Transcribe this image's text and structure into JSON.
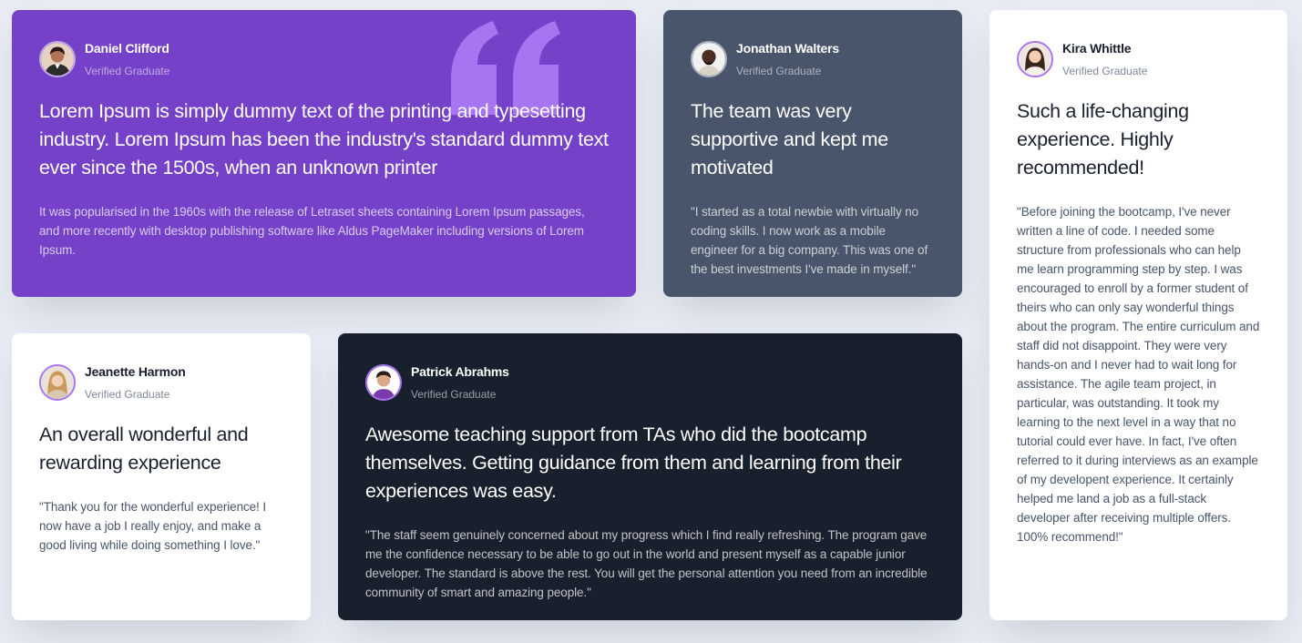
{
  "colors": {
    "background": "#e8ebf3",
    "purple": "#7541c8",
    "grayish_blue": "#48556a",
    "dark_blackish_blue": "#19202d",
    "white": "#ffffff",
    "light_purple": "#a775f1"
  },
  "testimonials": [
    {
      "name": "Daniel Clifford",
      "role": "Verified Graduate",
      "title": "Lorem Ipsum is simply dummy text of the printing and typesetting industry. Lorem Ipsum has been the industry's standard dummy text ever since the 1500s, when an unknown printer",
      "body": "It was popularised in the 1960s with the release of Letraset sheets containing Lorem Ipsum passages, and more recently with desktop publishing software like Aldus PageMaker including versions of Lorem Ipsum.",
      "decoration": "quote-icon"
    },
    {
      "name": "Jonathan Walters",
      "role": "Verified Graduate",
      "title": "The team was very supportive and kept me motivated",
      "body": "\"I started as a total newbie with virtually no coding skills. I now work as a mobile engineer for a big company. This was one of the best investments I've made in myself.\""
    },
    {
      "name": "Kira Whittle",
      "role": "Verified Graduate",
      "title": "Such a life-changing experience. Highly recommended!",
      "body": "\"Before joining the bootcamp, I've never written a line of code. I needed some structure from professionals who can help me learn programming step by step. I was encouraged to enroll by a former student of theirs who can only say wonderful things about the program. The entire curriculum and staff did not disappoint. They were very hands-on and I never had to wait long for assistance. The agile team project, in particular, was outstanding. It took my learning to the next level in a way that no tutorial could ever have. In fact, I've often referred to it during interviews as an example of my developent experience. It certainly helped me land a job as a full-stack developer after receiving multiple offers. 100% recommend!\""
    },
    {
      "name": "Jeanette Harmon",
      "role": "Verified Graduate",
      "title": "An overall wonderful and rewarding experience",
      "body": "\"Thank you for the wonderful experience! I now have a job I really enjoy, and make a good living while doing something I love.\""
    },
    {
      "name": "Patrick Abrahms",
      "role": "Verified Graduate",
      "title": "Awesome teaching support from TAs who did the bootcamp themselves. Getting guidance from them and learning from their experiences was easy.",
      "body": "\"The staff seem genuinely concerned about my progress which I find really refreshing. The program gave me the confidence necessary to be able to go out in the world and present myself as a capable junior developer. The standard is above the rest. You will get the personal attention you need from an incredible community of smart and amazing people.\""
    }
  ]
}
